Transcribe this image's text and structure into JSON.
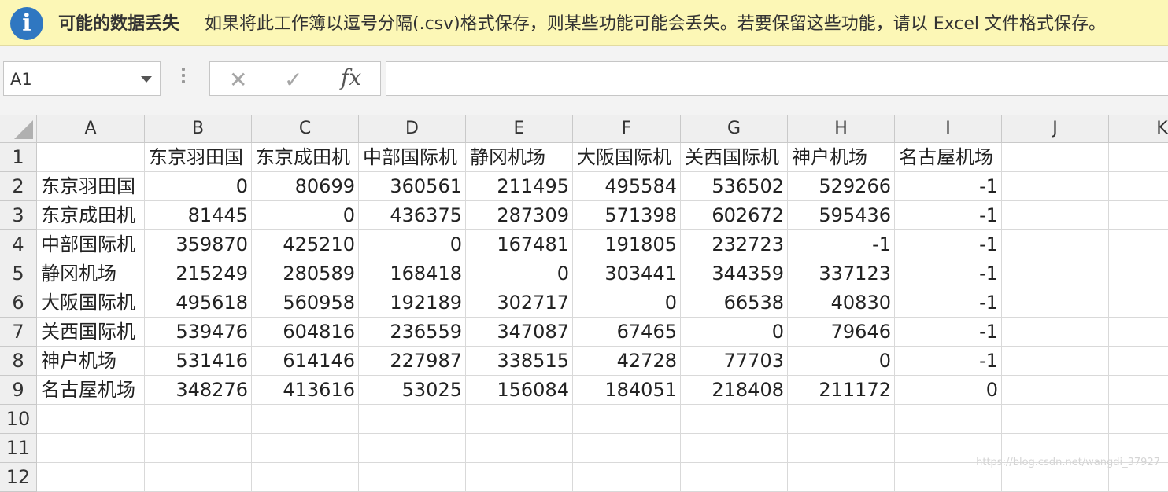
{
  "message_bar": {
    "title": "可能的数据丢失",
    "text": "如果将此工作簿以逗号分隔(.csv)格式保存，则某些功能可能会丢失。若要保留这些功能，请以 Excel 文件格式保存。"
  },
  "formula_bar": {
    "name_box": "A1",
    "cancel_symbol": "✕",
    "enter_symbol": "✓",
    "fx_label": "fx",
    "formula_value": ""
  },
  "columns": [
    "A",
    "B",
    "C",
    "D",
    "E",
    "F",
    "G",
    "H",
    "I",
    "J",
    "K"
  ],
  "rows": [
    "1",
    "2",
    "3",
    "4",
    "5",
    "6",
    "7",
    "8",
    "9",
    "10",
    "11",
    "12"
  ],
  "header_row": [
    "",
    "东京羽田国",
    "东京成田机",
    "中部国际机",
    "静冈机场",
    "大阪国际机",
    "关西国际机",
    "神户机场",
    "名古屋机场"
  ],
  "data_rows": [
    {
      "label": "东京羽田国",
      "values": [
        "0",
        "80699",
        "360561",
        "211495",
        "495584",
        "536502",
        "529266",
        "-1"
      ]
    },
    {
      "label": "东京成田机",
      "values": [
        "81445",
        "0",
        "436375",
        "287309",
        "571398",
        "602672",
        "595436",
        "-1"
      ]
    },
    {
      "label": "中部国际机",
      "values": [
        "359870",
        "425210",
        "0",
        "167481",
        "191805",
        "232723",
        "-1",
        "-1"
      ]
    },
    {
      "label": "静冈机场",
      "values": [
        "215249",
        "280589",
        "168418",
        "0",
        "303441",
        "344359",
        "337123",
        "-1"
      ]
    },
    {
      "label": "大阪国际机",
      "values": [
        "495618",
        "560958",
        "192189",
        "302717",
        "0",
        "66538",
        "40830",
        "-1"
      ]
    },
    {
      "label": "关西国际机",
      "values": [
        "539476",
        "604816",
        "236559",
        "347087",
        "67465",
        "0",
        "79646",
        "-1"
      ]
    },
    {
      "label": "神户机场",
      "values": [
        "531416",
        "614146",
        "227987",
        "338515",
        "42728",
        "77703",
        "0",
        "-1"
      ]
    },
    {
      "label": "名古屋机场",
      "values": [
        "348276",
        "413616",
        "53025",
        "156084",
        "184051",
        "218408",
        "211172",
        "0"
      ]
    }
  ],
  "watermark": "https://blog.csdn.net/wangdi_37927"
}
